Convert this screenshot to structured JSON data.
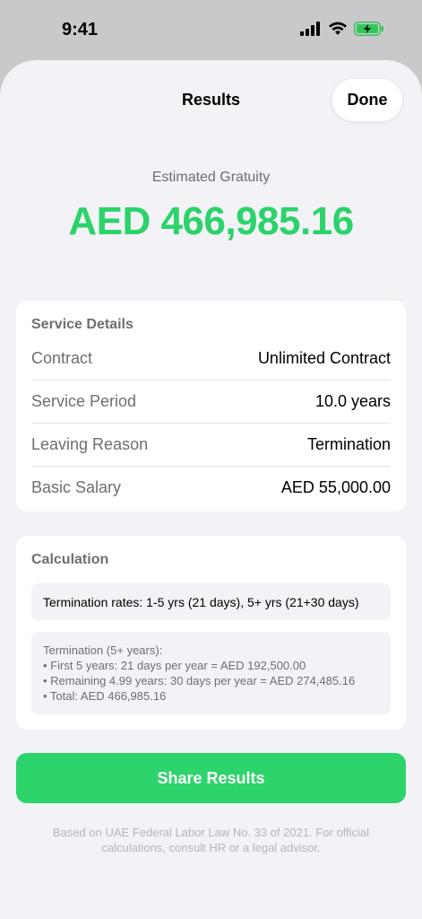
{
  "status_bar": {
    "time": "9:41",
    "icons": [
      "cellular-signal-icon",
      "wifi-icon",
      "battery-charging-icon"
    ],
    "battery_color": "#34c759"
  },
  "nav": {
    "title": "Results",
    "done_label": "Done"
  },
  "hero": {
    "label": "Estimated Gratuity",
    "amount": "AED 466,985.16",
    "accent_color": "#2bd36a"
  },
  "service_details": {
    "title": "Service Details",
    "rows": [
      {
        "label": "Contract",
        "value": "Unlimited Contract"
      },
      {
        "label": "Service Period",
        "value": "10.0 years"
      },
      {
        "label": "Leaving Reason",
        "value": "Termination"
      },
      {
        "label": "Basic Salary",
        "value": "AED 55,000.00"
      }
    ]
  },
  "calculation": {
    "title": "Calculation",
    "rates": "Termination rates: 1-5 yrs (21 days), 5+ yrs (21+30 days)",
    "lines": [
      "Termination (5+ years):",
      "• First 5 years: 21 days per year = AED 192,500.00",
      "• Remaining 4.99 years: 30 days per year = AED 274,485.16",
      "• Total: AED 466,985.16"
    ]
  },
  "share_button": {
    "label": "Share Results",
    "color": "#2dd36b"
  },
  "footnote": "Based on UAE Federal Labor Law No. 33 of 2021. For official calculations, consult HR or a legal advisor."
}
